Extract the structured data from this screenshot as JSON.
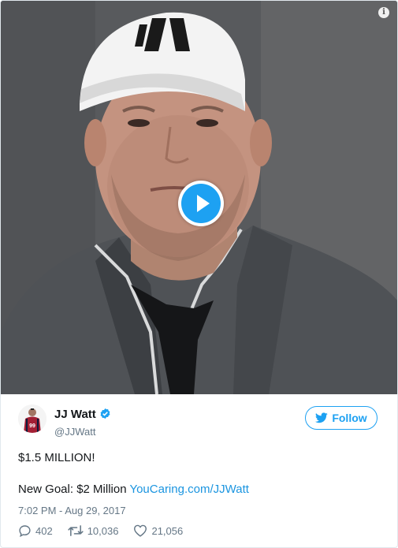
{
  "tweet": {
    "display_name": "JJ Watt",
    "handle": "@JJWatt",
    "follow_label": "Follow",
    "line1": "$1.5 MILLION!",
    "line2_prefix": "New Goal: $2 Million ",
    "link": "YouCaring.com/JJWatt",
    "timestamp": "7:02 PM - Aug 29, 2017",
    "replies": "402",
    "retweets": "10,036",
    "likes": "21,056"
  },
  "icons": {
    "info": "info-icon",
    "play": "play-icon",
    "verified": "verified-badge-icon",
    "follow": "twitter-bird-icon",
    "reply": "reply-icon",
    "retweet": "retweet-icon",
    "like": "heart-icon"
  },
  "colors": {
    "accent": "#1da1f2",
    "link": "#1b95e0",
    "muted": "#657786",
    "text": "#14171a"
  }
}
